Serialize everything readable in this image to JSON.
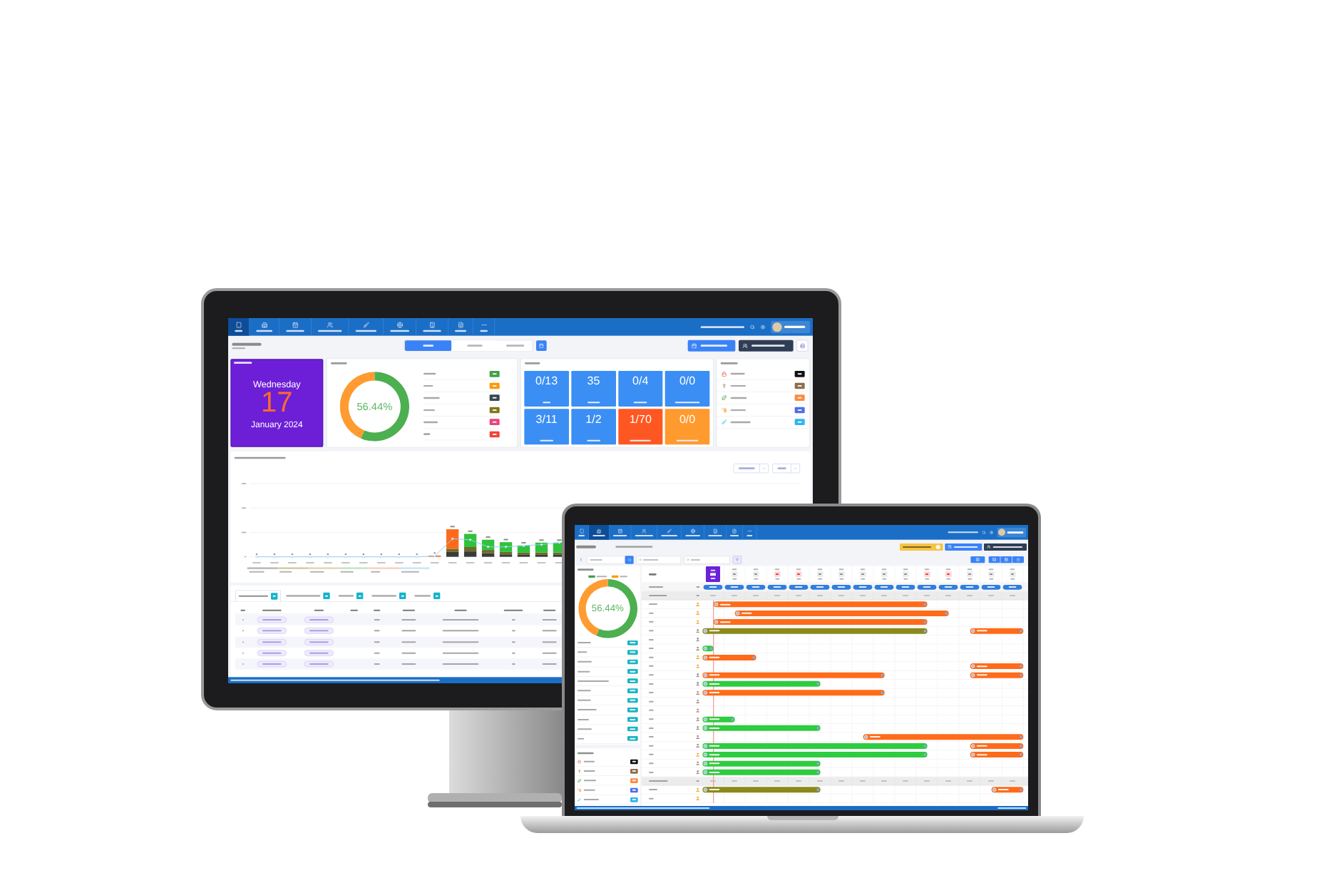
{
  "monitor": {
    "nav": {
      "items": [
        {
          "selected": true
        },
        {
          "selected": false
        },
        {
          "selected": false
        },
        {
          "selected": false
        },
        {
          "selected": false
        },
        {
          "selected": false
        },
        {
          "selected": false
        },
        {
          "selected": false
        },
        {
          "selected": false
        }
      ]
    },
    "day_tabs": [
      {
        "selected": true
      },
      {
        "selected": false
      }
    ],
    "system_date": {
      "weekday": "Wednesday",
      "day": "17",
      "month": "January 2024"
    },
    "occupancy": {
      "percent": "56.44%",
      "chart_data": {
        "type": "donut",
        "values": [
          56.44,
          43.56
        ]
      },
      "badges": [
        {
          "color": "#43a047"
        },
        {
          "color": "#ff9800"
        },
        {
          "color": "#37474f"
        },
        {
          "color": "#827717"
        },
        {
          "color": "#ec407a"
        },
        {
          "color": "#f44336"
        }
      ]
    },
    "summary": {
      "tiles": [
        {
          "value": "0/13",
          "color": "#3b8ef3"
        },
        {
          "value": "35",
          "color": "#3b8ef3"
        },
        {
          "value": "0/4",
          "color": "#3b8ef3"
        },
        {
          "value": "0/0",
          "color": "#3b8ef3"
        },
        {
          "value": "3/11",
          "color": "#3b8ef3"
        },
        {
          "value": "1/2",
          "color": "#3b8ef3"
        },
        {
          "value": "1/70",
          "color": "#ff5722"
        },
        {
          "value": "0/0",
          "color": "#ff9a2e"
        }
      ]
    },
    "room_status": {
      "badges": [
        {
          "color": "#111111"
        },
        {
          "color": "#8d6e4a"
        },
        {
          "color": "#ff8a3d"
        },
        {
          "color": "#4f6bed"
        },
        {
          "color": "#29b6f6"
        }
      ]
    },
    "chart": {
      "legend": [
        {
          "color": "#bdbdbd"
        },
        {
          "color": "#d6cfa8"
        },
        {
          "color": "#e6d8b8"
        },
        {
          "color": "#c8e6c9"
        },
        {
          "color": "#fcd5bd"
        },
        {
          "color": "#c9e7f6"
        }
      ]
    },
    "tabs": [
      {
        "selected": true
      },
      {
        "selected": false
      },
      {
        "selected": false
      },
      {
        "selected": false
      },
      {
        "selected": false
      }
    ]
  },
  "laptop": {
    "nav": {
      "items": [
        {
          "selected": false
        },
        {
          "selected": true
        },
        {
          "selected": false
        },
        {
          "selected": false
        },
        {
          "selected": false
        },
        {
          "selected": false
        },
        {
          "selected": false
        },
        {
          "selected": false
        },
        {
          "selected": false
        }
      ]
    },
    "today_guest": {
      "percent": "56.44%",
      "chart_data": {
        "type": "donut",
        "values": [
          56.44,
          43.56
        ]
      },
      "legend": [
        {
          "color": "#43a047"
        },
        {
          "color": "#ff9800"
        }
      ]
    },
    "room_status": {
      "badges": [
        {
          "color": "#111111"
        },
        {
          "color": "#8d6e4a"
        },
        {
          "color": "#ff8a3d"
        },
        {
          "color": "#4f6bed"
        },
        {
          "color": "#29b6f6"
        }
      ]
    },
    "timeline": {
      "days": [
        {
          "selected": true,
          "weekend": false
        },
        {
          "selected": false,
          "weekend": false
        },
        {
          "selected": false,
          "weekend": false
        },
        {
          "selected": false,
          "weekend": true
        },
        {
          "selected": false,
          "weekend": true
        },
        {
          "selected": false,
          "weekend": false
        },
        {
          "selected": false,
          "weekend": false
        },
        {
          "selected": false,
          "weekend": false
        },
        {
          "selected": false,
          "weekend": false
        },
        {
          "selected": false,
          "weekend": false
        },
        {
          "selected": false,
          "weekend": true
        },
        {
          "selected": false,
          "weekend": true
        },
        {
          "selected": false,
          "weekend": false
        },
        {
          "selected": false,
          "weekend": false
        },
        {
          "selected": false,
          "weekend": false
        }
      ],
      "groups": [
        {
          "rooms": [
            {
              "color": "#f5a623"
            },
            {
              "color": "#f5a623"
            },
            {
              "color": "#f5a623"
            },
            {
              "color": "#a1887f"
            },
            {
              "color": "#a1887f"
            },
            {
              "color": "#a1887f"
            },
            {
              "color": "#f5a623"
            },
            {
              "color": "#f5a623"
            },
            {
              "color": "#a1887f"
            },
            {
              "color": "#a1887f"
            },
            {
              "color": "#a1887f"
            },
            {
              "color": "#a1887f"
            },
            {
              "color": "#a1887f"
            },
            {
              "color": "#a1887f"
            },
            {
              "color": "#a1887f"
            },
            {
              "color": "#a1887f"
            },
            {
              "color": "#a1887f"
            },
            {
              "color": "#f5a623"
            },
            {
              "color": "#a1887f"
            },
            {
              "color": "#a1887f"
            }
          ]
        },
        {
          "rooms": [
            {
              "color": "#f5a623"
            },
            {
              "color": "#f5a623"
            }
          ]
        }
      ]
    }
  }
}
